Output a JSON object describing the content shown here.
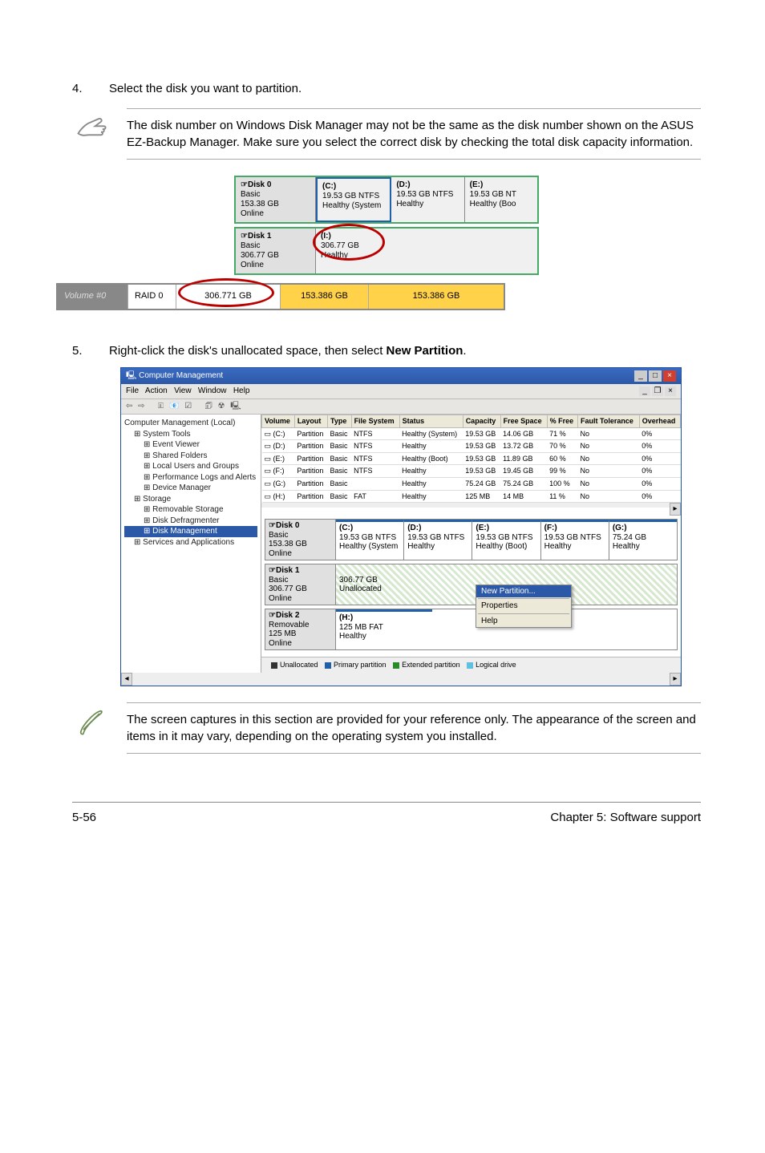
{
  "steps": {
    "s4": {
      "num": "4.",
      "text": "Select the disk you want to partition."
    },
    "s5": {
      "num": "5.",
      "text_a": "Right-click the disk's unallocated space, then select ",
      "bold": "New Partition",
      "text_b": "."
    }
  },
  "note1": {
    "text": "The disk number on Windows Disk Manager may not be the same as the disk number shown on the ASUS EZ-Backup Manager. Make sure you select the correct disk by checking the total disk capacity information."
  },
  "note2": {
    "text": "The screen captures in this section are provided for your reference only. The appearance of the screen and items in it may vary, depending on the operating system you installed."
  },
  "shot1": {
    "disk0": {
      "name": "Disk 0",
      "type": "Basic",
      "size": "153.38 GB",
      "status": "Online",
      "parts": [
        {
          "drv": "(C:)",
          "size": "19.53 GB NTFS",
          "stat": "Healthy (System"
        },
        {
          "drv": "(D:)",
          "size": "19.53 GB NTFS",
          "stat": "Healthy"
        },
        {
          "drv": "(E:)",
          "size": "19.53 GB NT",
          "stat": "Healthy (Boo"
        }
      ]
    },
    "disk1": {
      "name": "Disk 1",
      "type": "Basic",
      "size": "306.77 GB",
      "status": "Online",
      "parts": [
        {
          "drv": "(I:)",
          "size": "306.77 GB",
          "stat": "Healthy"
        }
      ]
    },
    "raidbar": {
      "label": "Volume #0",
      "name": "RAID 0",
      "total": "306.771 GB",
      "free": "153.386 GB",
      "free2": "153.386 GB"
    }
  },
  "shot2": {
    "title": "Computer Management",
    "menus": [
      "File",
      "Action",
      "View",
      "Window",
      "Help"
    ],
    "tree": [
      {
        "lvl": 0,
        "t": "Computer Management (Local)"
      },
      {
        "lvl": 1,
        "t": "System Tools"
      },
      {
        "lvl": 2,
        "t": "Event Viewer"
      },
      {
        "lvl": 2,
        "t": "Shared Folders"
      },
      {
        "lvl": 2,
        "t": "Local Users and Groups"
      },
      {
        "lvl": 2,
        "t": "Performance Logs and Alerts"
      },
      {
        "lvl": 2,
        "t": "Device Manager"
      },
      {
        "lvl": 1,
        "t": "Storage"
      },
      {
        "lvl": 2,
        "t": "Removable Storage"
      },
      {
        "lvl": 2,
        "t": "Disk Defragmenter"
      },
      {
        "lvl": 2,
        "t": "Disk Management",
        "sel": true
      },
      {
        "lvl": 1,
        "t": "Services and Applications"
      }
    ],
    "table": {
      "cols": [
        "Volume",
        "Layout",
        "Type",
        "File System",
        "Status",
        "Capacity",
        "Free Space",
        "% Free",
        "Fault Tolerance",
        "Overhead"
      ],
      "rows": [
        [
          "(C:)",
          "Partition",
          "Basic",
          "NTFS",
          "Healthy (System)",
          "19.53 GB",
          "14.06 GB",
          "71 %",
          "No",
          "0%"
        ],
        [
          "(D:)",
          "Partition",
          "Basic",
          "NTFS",
          "Healthy",
          "19.53 GB",
          "13.72 GB",
          "70 %",
          "No",
          "0%"
        ],
        [
          "(E:)",
          "Partition",
          "Basic",
          "NTFS",
          "Healthy (Boot)",
          "19.53 GB",
          "11.89 GB",
          "60 %",
          "No",
          "0%"
        ],
        [
          "(F:)",
          "Partition",
          "Basic",
          "NTFS",
          "Healthy",
          "19.53 GB",
          "19.45 GB",
          "99 %",
          "No",
          "0%"
        ],
        [
          "(G:)",
          "Partition",
          "Basic",
          "",
          "Healthy",
          "75.24 GB",
          "75.24 GB",
          "100 %",
          "No",
          "0%"
        ],
        [
          "(H:)",
          "Partition",
          "Basic",
          "FAT",
          "Healthy",
          "125 MB",
          "14 MB",
          "11 %",
          "No",
          "0%"
        ]
      ]
    },
    "disks": {
      "d0": {
        "name": "Disk 0",
        "type": "Basic",
        "size": "153.38 GB",
        "stat": "Online",
        "segs": [
          {
            "drv": "(C:)",
            "sz": "19.53 GB NTFS",
            "st": "Healthy (System"
          },
          {
            "drv": "(D:)",
            "sz": "19.53 GB NTFS",
            "st": "Healthy"
          },
          {
            "drv": "(E:)",
            "sz": "19.53 GB NTFS",
            "st": "Healthy (Boot)"
          },
          {
            "drv": "(F:)",
            "sz": "19.53 GB NTFS",
            "st": "Healthy"
          },
          {
            "drv": "(G:)",
            "sz": "75.24 GB",
            "st": "Healthy"
          }
        ]
      },
      "d1": {
        "name": "Disk 1",
        "type": "Basic",
        "size": "306.77 GB",
        "stat": "Online",
        "segs": [
          {
            "drv": "",
            "sz": "306.77 GB",
            "st": "Unallocated"
          }
        ]
      },
      "d2": {
        "name": "Disk 2",
        "type": "Removable",
        "size": "125 MB",
        "stat": "Online",
        "segs": [
          {
            "drv": "(H:)",
            "sz": "125 MB FAT",
            "st": "Healthy"
          }
        ]
      }
    },
    "context": [
      "New Partition...",
      "Properties",
      "Help"
    ],
    "legend": [
      "Unallocated",
      "Primary partition",
      "Extended partition",
      "Logical drive"
    ],
    "legend_colors": [
      "#333",
      "#2060a8",
      "#2a8a2a",
      "#60c0e0"
    ]
  },
  "footer": {
    "left": "5-56",
    "right": "Chapter 5: Software support"
  }
}
